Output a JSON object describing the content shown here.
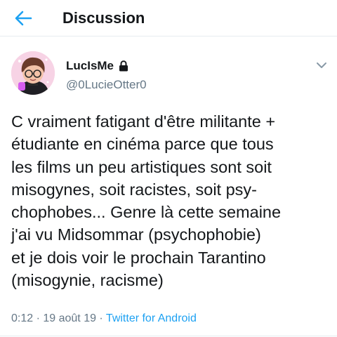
{
  "header": {
    "title": "Discussion"
  },
  "tweet": {
    "author": {
      "display_name": "LucIsMe",
      "handle": "@0LucieOtter0"
    },
    "text_lines": [
      "C vraiment fatigant d'être militante +",
      "étudiante en cinéma parce que tous",
      "les films un peu artistiques sont soit",
      "misogynes, soit racistes, soit psy-",
      "chophobes... Genre là cette semaine",
      "j'ai vu Midsommar (psychophobie)",
      "et je dois voir le prochain Tarantino",
      "(misogynie, racisme)"
    ],
    "meta": {
      "time": "0:12",
      "separator": " · ",
      "date": "19 août 19",
      "source": "Twitter for Android"
    }
  },
  "icons": {
    "back": "arrow-left-icon",
    "lock": "lock-icon",
    "more": "chevron-down-icon"
  },
  "colors": {
    "accent": "#1da1f2",
    "text": "#14171a",
    "secondary": "#657786",
    "divider": "#e6ecf0"
  }
}
